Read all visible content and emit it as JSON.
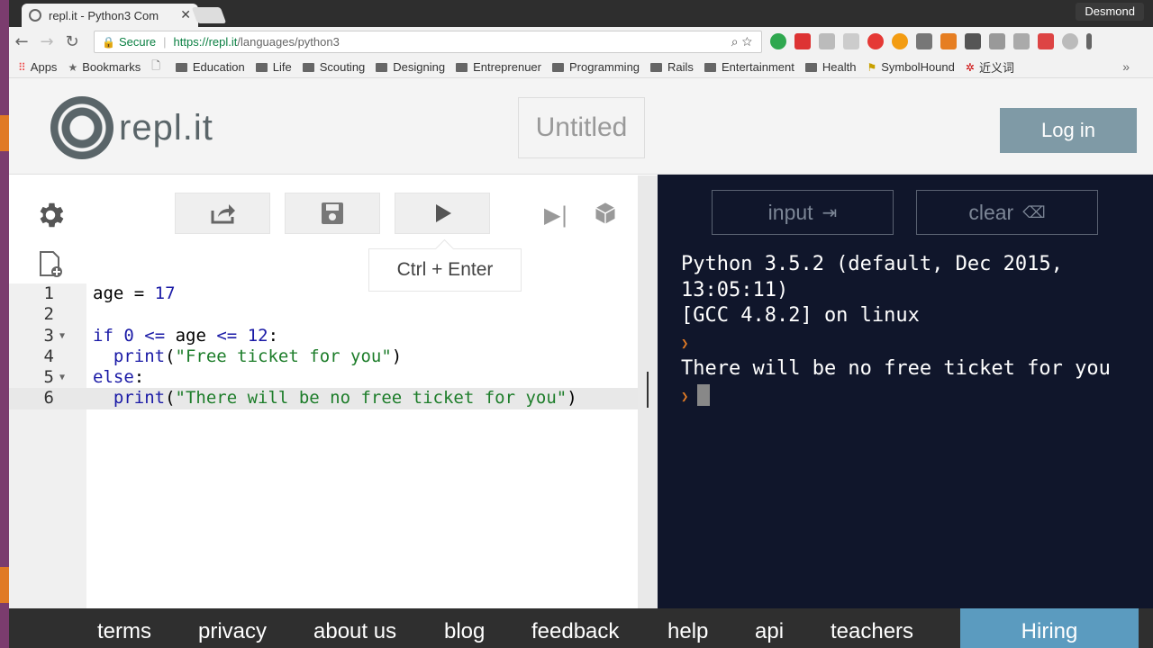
{
  "browser": {
    "tab_title": "repl.it - Python3 Com",
    "tab_close": "✕",
    "user": "Desmond",
    "secure_label": "Secure",
    "url_host": "https://repl.it",
    "url_path": "/languages/python3",
    "bookmarks": [
      "Apps",
      "Bookmarks",
      "Education",
      "Life",
      "Scouting",
      "Designing",
      "Entreprenuer",
      "Programming",
      "Rails",
      "Entertainment",
      "Health",
      "SymbolHound",
      "近义词"
    ],
    "more": "»"
  },
  "header": {
    "logo_text": "repl.it",
    "title": "Untitled",
    "login": "Log in"
  },
  "editor": {
    "tooltip": "Ctrl + Enter",
    "line_numbers": [
      "1",
      "2",
      "3",
      "4",
      "5",
      "6"
    ]
  },
  "console": {
    "input_label": "input",
    "clear_label": "clear",
    "output": {
      "banner1": "Python 3.5.2 (default, Dec 2015, 13:05:11)",
      "banner2": "[GCC 4.8.2] on linux",
      "result": "There will be no free ticket for you"
    }
  },
  "footer": {
    "links": [
      "terms",
      "privacy",
      "about us",
      "blog",
      "feedback",
      "help",
      "api",
      "teachers"
    ],
    "hiring": "Hiring"
  },
  "colors": {
    "console_bg": "#10162b",
    "login_bg": "#7f9aa6",
    "hiring_bg": "#5b9bbf",
    "prompt": "#e07a25"
  }
}
